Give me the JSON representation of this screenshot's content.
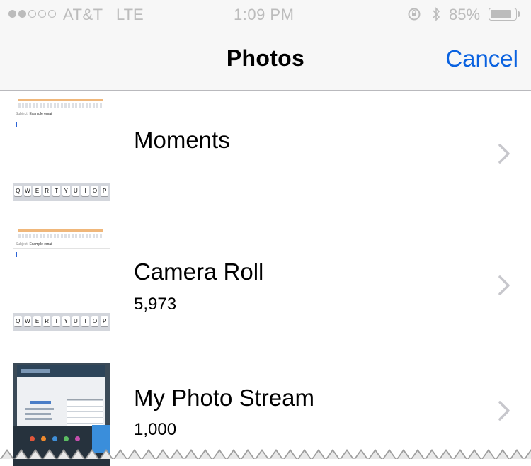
{
  "status_bar": {
    "carrier": "AT&T",
    "network": "LTE",
    "time": "1:09 PM",
    "battery_percent": "85%",
    "signal_strength": 2,
    "signal_max": 5,
    "icons": [
      "signal-dots-icon",
      "rotation-lock-icon",
      "bluetooth-icon",
      "battery-icon"
    ]
  },
  "nav": {
    "title": "Photos",
    "cancel_label": "Cancel"
  },
  "albums": [
    {
      "name": "Moments",
      "count": "",
      "thumbnail": "keyboard-screenshot"
    },
    {
      "name": "Camera Roll",
      "count": "5,973",
      "thumbnail": "keyboard-screenshot"
    },
    {
      "name": "My Photo Stream",
      "count": "1,000",
      "thumbnail": "desktop-photo"
    }
  ],
  "thumbnail_text": {
    "subject_label": "Subject:",
    "subject_value": "Example email",
    "keys": [
      "Q",
      "W",
      "E",
      "R",
      "T",
      "Y",
      "U",
      "I",
      "O",
      "P"
    ]
  },
  "colors": {
    "accent": "#0a62e0",
    "nav_background": "#f7f7f7",
    "divider": "#c8c7cc",
    "chevron": "#c7c7cc",
    "status_text": "#bcbcbc"
  }
}
